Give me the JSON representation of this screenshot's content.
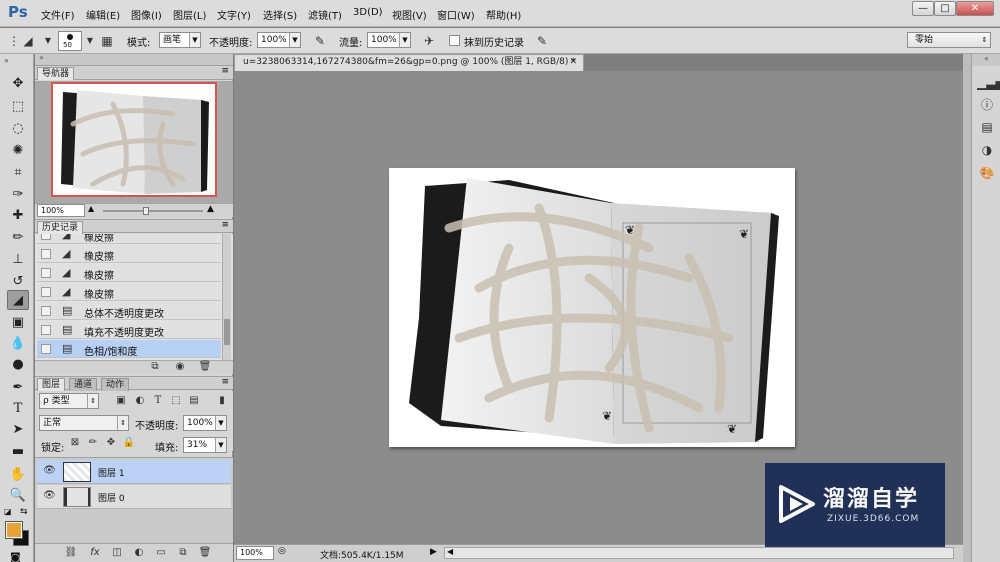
{
  "app": {
    "logo": "Ps",
    "menus": [
      "文件(F)",
      "编辑(E)",
      "图像(I)",
      "图层(L)",
      "文字(Y)",
      "选择(S)",
      "滤镜(T)",
      "3D(D)",
      "视图(V)",
      "窗口(W)",
      "帮助(H)"
    ],
    "window_buttons": [
      "—",
      "□",
      "✕"
    ]
  },
  "options": {
    "brush_size": "50",
    "mode_label": "模式:",
    "mode_value": "画笔",
    "opacity_label": "不透明度:",
    "opacity_value": "100%",
    "flow_label": "流量:",
    "flow_value": "100%",
    "erase_history_label": "抹到历史记录",
    "workspace": "零始"
  },
  "navigator": {
    "title": "导航器",
    "zoom": "100%"
  },
  "history": {
    "title": "历史记录",
    "items": [
      {
        "label": "橡皮擦"
      },
      {
        "label": "橡皮擦"
      },
      {
        "label": "橡皮擦"
      },
      {
        "label": "橡皮擦"
      },
      {
        "label": "总体不透明度更改"
      },
      {
        "label": "填充不透明度更改"
      },
      {
        "label": "色相/饱和度"
      }
    ]
  },
  "layers": {
    "tabs": [
      "图层",
      "通道",
      "动作"
    ],
    "kind_filter": "ρ 类型",
    "blend_mode": "正常",
    "opacity_label": "不透明度:",
    "opacity_value": "100%",
    "lock_label": "锁定:",
    "fill_label": "填充:",
    "fill_value": "31%",
    "items": [
      {
        "name": "图层 1",
        "selected": true
      },
      {
        "name": "图层 0",
        "selected": false
      }
    ],
    "footer_icons": [
      "link-icon",
      "fx-icon",
      "mask-icon",
      "adjustment-icon",
      "folder-icon",
      "new-layer-icon",
      "trash-icon"
    ]
  },
  "document": {
    "tab_title": "u=3238063314,167274380&fm=26&gp=0.png @ 100% (图层 1, RGB/8) *",
    "zoom": "100%",
    "doc_info": "文档:505.4K/1.15M"
  },
  "watermark": {
    "title": "溜溜自学",
    "subtitle": "ZIXUE.3D66.COM"
  },
  "colors": {
    "ps_blue": "#2f64a8",
    "selection_blue": "#b9d0f5",
    "foreground": "#e8a33a",
    "background": "#111111",
    "watermark_bg": "#1b2c55"
  }
}
